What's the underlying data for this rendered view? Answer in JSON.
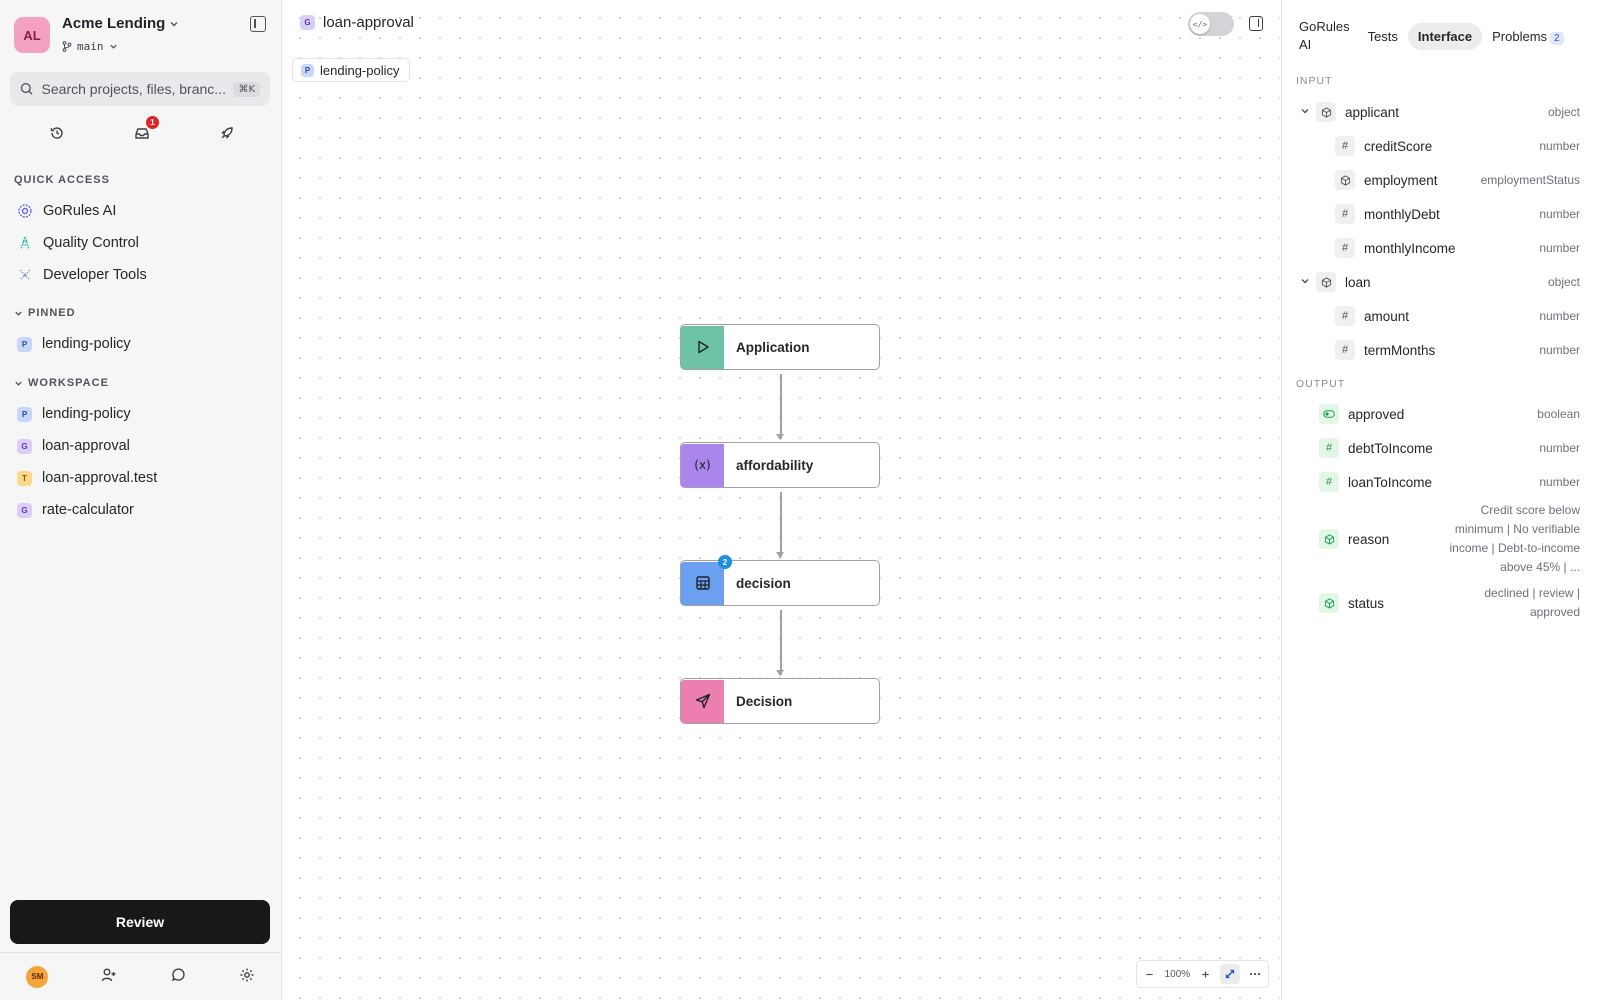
{
  "org": {
    "initials": "AL",
    "name": "Acme Lending",
    "branch": "main"
  },
  "search": {
    "placeholder": "Search projects, files, branc...",
    "shortcut": "⌘K"
  },
  "notifications": {
    "inbox_count": "1"
  },
  "quick_access": {
    "heading": "QUICK ACCESS",
    "items": [
      {
        "label": "GoRules AI",
        "icon": "gorules-ai-icon"
      },
      {
        "label": "Quality Control",
        "icon": "quality-control-icon"
      },
      {
        "label": "Developer Tools",
        "icon": "developer-tools-icon"
      }
    ]
  },
  "pinned": {
    "heading": "PINNED",
    "items": [
      {
        "label": "lending-policy",
        "badge": "P"
      }
    ]
  },
  "workspace": {
    "heading": "WORKSPACE",
    "items": [
      {
        "label": "lending-policy",
        "badge": "P"
      },
      {
        "label": "loan-approval",
        "badge": "G"
      },
      {
        "label": "loan-approval.test",
        "badge": "T"
      },
      {
        "label": "rate-calculator",
        "badge": "G"
      }
    ]
  },
  "review_label": "Review",
  "user": {
    "initials": "SM"
  },
  "editor": {
    "badge": "G",
    "title": "loan-approval",
    "breadcrumb_badge": "P",
    "breadcrumb": "lending-policy",
    "toggle_icon": "</>"
  },
  "graph": {
    "nodes": [
      {
        "label": "Application",
        "type": "input",
        "color": "#6cc4a4"
      },
      {
        "label": "affordability",
        "type": "expression",
        "color": "#a985ec",
        "icon_text": "(x)"
      },
      {
        "label": "decision",
        "type": "decision-table",
        "color": "#6b9ff0",
        "badge": "2"
      },
      {
        "label": "Decision",
        "type": "output",
        "color": "#ec7fb0"
      }
    ]
  },
  "zoom": {
    "level": "100%"
  },
  "panel": {
    "tabs": [
      {
        "label": "GoRules AI",
        "active": false
      },
      {
        "label": "Tests",
        "active": false
      },
      {
        "label": "Interface",
        "active": true
      },
      {
        "label": "Problems",
        "active": false,
        "count": "2"
      }
    ],
    "input_heading": "INPUT",
    "output_heading": "OUTPUT",
    "input": [
      {
        "name": "applicant",
        "type": "object",
        "icon": "cube-icon"
      },
      {
        "name": "creditScore",
        "type": "number",
        "icon": "hash-icon"
      },
      {
        "name": "employment",
        "type": "employmentStatus",
        "icon": "cube-icon"
      },
      {
        "name": "monthlyDebt",
        "type": "number",
        "icon": "hash-icon"
      },
      {
        "name": "monthlyIncome",
        "type": "number",
        "icon": "hash-icon"
      },
      {
        "name": "loan",
        "type": "object",
        "icon": "cube-icon"
      },
      {
        "name": "amount",
        "type": "number",
        "icon": "hash-icon"
      },
      {
        "name": "termMonths",
        "type": "number",
        "icon": "hash-icon"
      }
    ],
    "output": [
      {
        "name": "approved",
        "type": "boolean",
        "icon": "toggle-icon"
      },
      {
        "name": "debtToIncome",
        "type": "number",
        "icon": "hash-icon"
      },
      {
        "name": "loanToIncome",
        "type": "number",
        "icon": "hash-icon"
      },
      {
        "name": "reason",
        "type": "Credit score below minimum | No verifiable income | Debt-to-income above 45% | ...",
        "icon": "cube-icon"
      },
      {
        "name": "status",
        "type": "declined | review | approved",
        "icon": "cube-icon"
      }
    ]
  }
}
